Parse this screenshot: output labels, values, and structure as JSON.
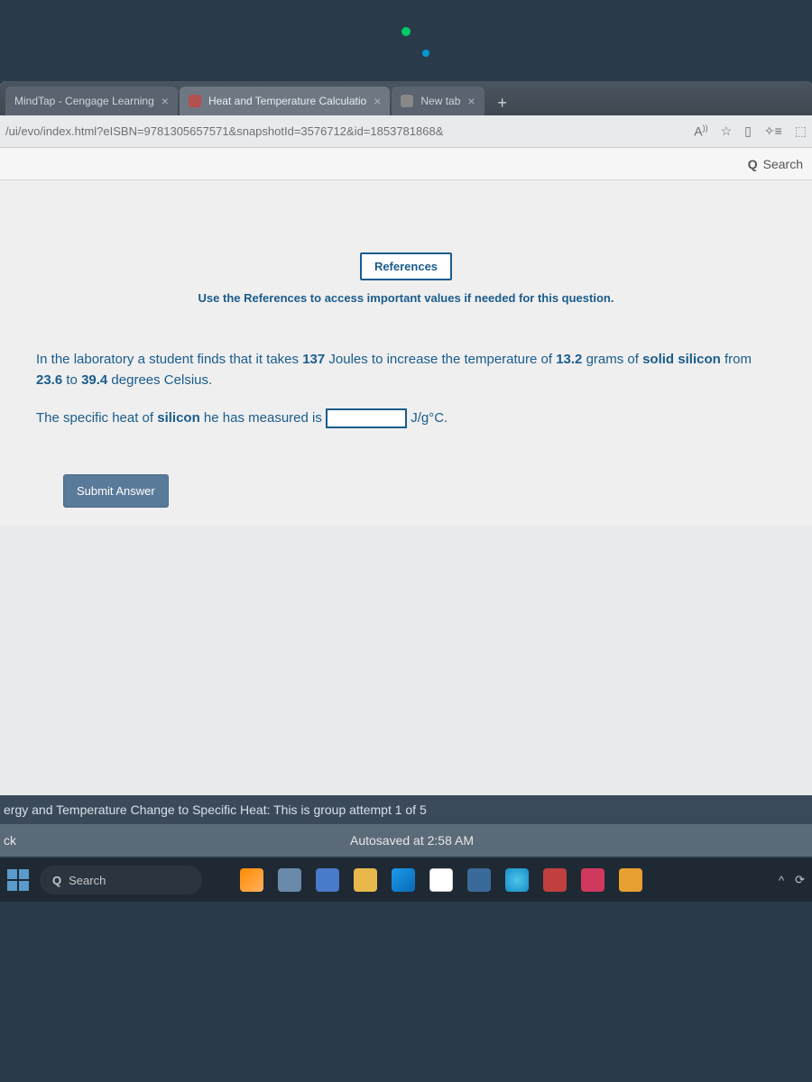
{
  "browser": {
    "tabs": [
      {
        "label": "MindTap - Cengage Learning",
        "active": false
      },
      {
        "label": "Heat and Temperature Calculatio",
        "active": true
      },
      {
        "label": "New tab",
        "active": false
      }
    ],
    "url": "/ui/evo/index.html?eISBN=9781305657571&snapshotId=3576712&id=1853781868&",
    "search_label": "Search"
  },
  "page": {
    "references_button": "References",
    "references_hint": "Use the References to access important values if needed for this question.",
    "question_line1_a": "In the laboratory a student finds that it takes ",
    "question_line1_b": "137",
    "question_line1_c": " Joules to increase the temperature of ",
    "question_line1_d": "13.2",
    "question_line1_e": " grams of ",
    "question_line1_f": "solid silicon",
    "question_line1_g": " from ",
    "question_line1_h": "23.6",
    "question_line1_i": " to ",
    "question_line1_j": "39.4",
    "question_line1_k": " degrees Celsius.",
    "question_line2_a": "The specific heat of ",
    "question_line2_b": "silicon",
    "question_line2_c": " he has measured is ",
    "question_line2_units": "J/g°C.",
    "submit": "Submit Answer"
  },
  "footer": {
    "attempt": "ergy and Temperature Change to Specific Heat: This is group attempt 1 of 5",
    "back_fragment": "ck",
    "autosave": "Autosaved at 2:58 AM"
  },
  "taskbar": {
    "search": "Search"
  }
}
